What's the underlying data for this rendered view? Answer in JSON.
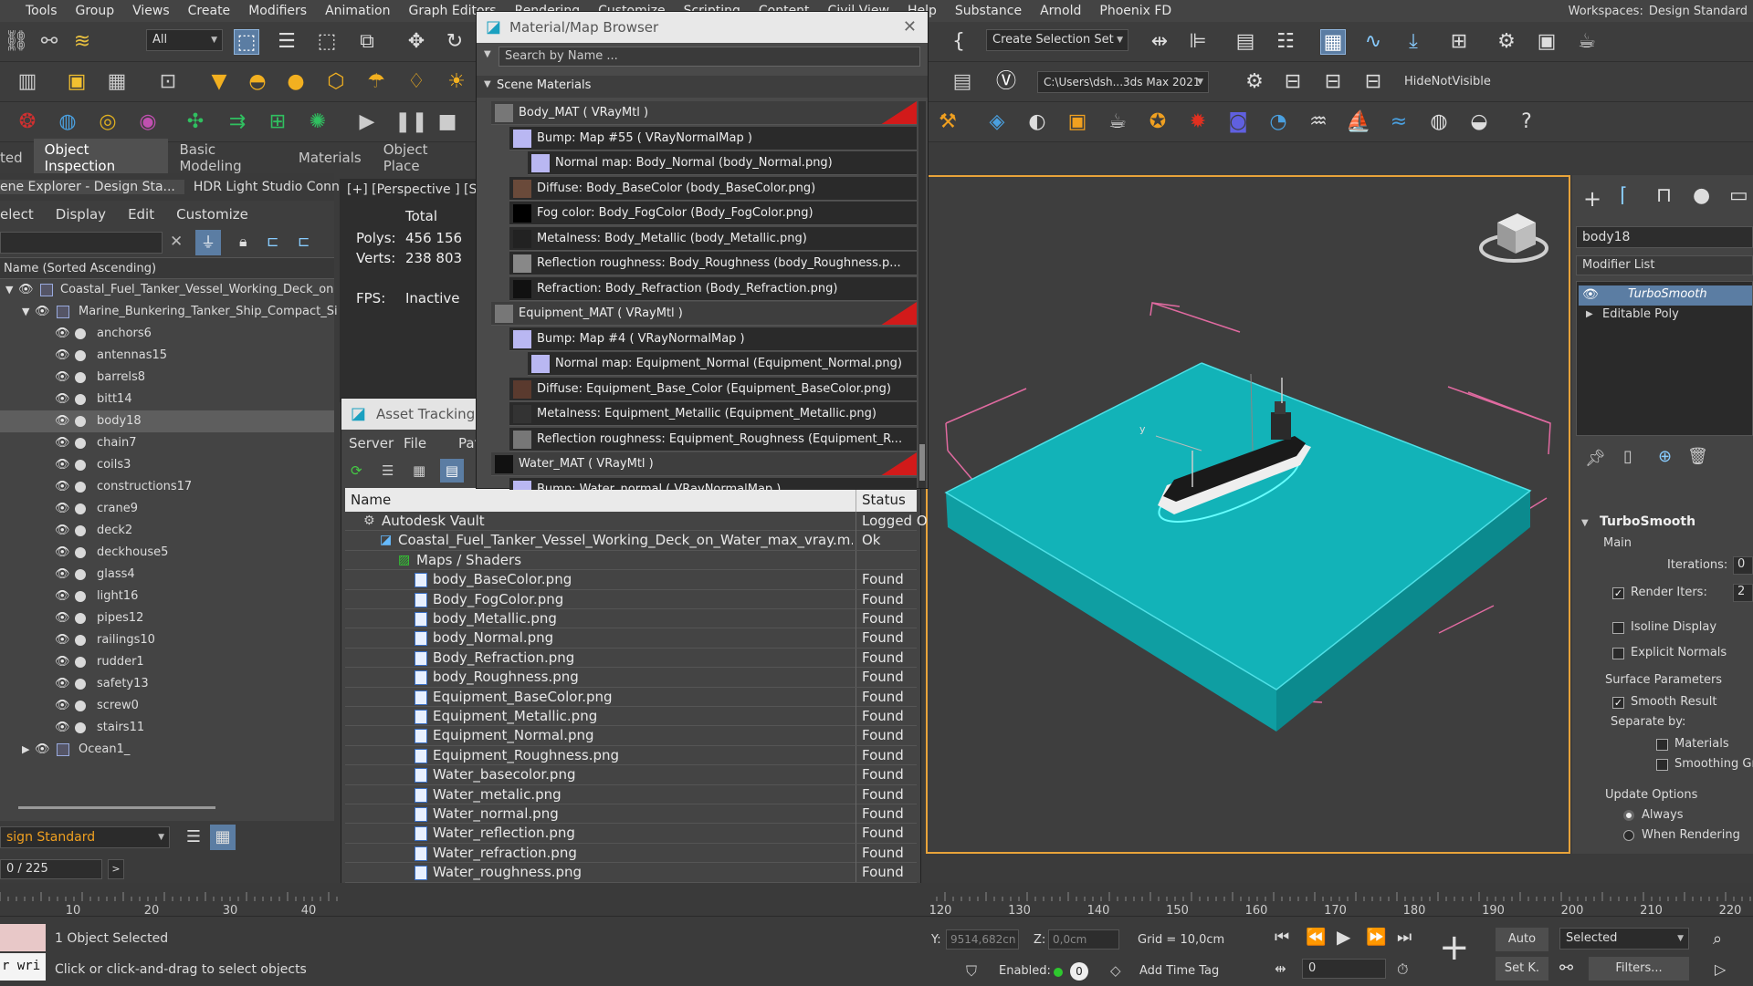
{
  "menubar": {
    "items": [
      "Tools",
      "Group",
      "Views",
      "Create",
      "Modifiers",
      "Animation",
      "Graph Editors",
      "Rendering",
      "Customize",
      "Scripting",
      "Content",
      "Civil View",
      "Help",
      "Substance",
      "Arnold",
      "Phoenix FD"
    ],
    "workspaces_label": "Workspaces:",
    "workspace_value": "Design Standard"
  },
  "toolbar": {
    "selection_filter": "All",
    "create_selection_set": "Create Selection Set",
    "path": "C:\\Users\\dsh...3ds Max 2021",
    "hide_not_visible": "HideNotVisible"
  },
  "ribbon": {
    "tabs": [
      "ted",
      "Object Inspection",
      "Basic Modeling",
      "Materials",
      "Object Place"
    ]
  },
  "scene_explorer": {
    "tabs": [
      "ene Explorer - Design Sta...",
      "HDR Light Studio Conn..."
    ],
    "menu": [
      "elect",
      "Display",
      "Edit",
      "Customize"
    ],
    "column_header": "Name (Sorted Ascending)",
    "tree": [
      {
        "label": "Coastal_Fuel_Tanker_Vessel_Working_Deck_on",
        "level": 0
      },
      {
        "label": "Marine_Bunkering_Tanker_Ship_Compact_Si",
        "level": 1
      },
      {
        "label": "anchors6",
        "level": 2
      },
      {
        "label": "antennas15",
        "level": 2
      },
      {
        "label": "barrels8",
        "level": 2
      },
      {
        "label": "bitt14",
        "level": 2
      },
      {
        "label": "body18",
        "level": 2,
        "selected": true
      },
      {
        "label": "chain7",
        "level": 2
      },
      {
        "label": "coils3",
        "level": 2
      },
      {
        "label": "constructions17",
        "level": 2
      },
      {
        "label": "crane9",
        "level": 2
      },
      {
        "label": "deck2",
        "level": 2
      },
      {
        "label": "deckhouse5",
        "level": 2
      },
      {
        "label": "glass4",
        "level": 2
      },
      {
        "label": "light16",
        "level": 2
      },
      {
        "label": "pipes12",
        "level": 2
      },
      {
        "label": "railings10",
        "level": 2
      },
      {
        "label": "rudder1",
        "level": 2
      },
      {
        "label": "safety13",
        "level": 2
      },
      {
        "label": "screw0",
        "level": 2
      },
      {
        "label": "stairs11",
        "level": 2
      },
      {
        "label": "Ocean1_",
        "level": 1
      }
    ],
    "layer_label": "sign Standard",
    "frame_counter": "0 / 225"
  },
  "viewport_stats": {
    "label": "[+] [Perspective ] [S",
    "total": "Total",
    "polys_label": "Polys:",
    "polys_value": "456 156",
    "verts_label": "Verts:",
    "verts_value": "238 803",
    "fps_label": "FPS:",
    "fps_value": "Inactive"
  },
  "material_browser": {
    "title": "Material/Map Browser",
    "search_placeholder": "Search by Name ...",
    "section": "Scene Materials",
    "rows": [
      {
        "text": "Body_MAT  ( VRayMtl )",
        "kind": "mat",
        "indent": 0,
        "swatch": "#777"
      },
      {
        "text": "Bump: Map #55  ( VRayNormalMap )",
        "kind": "map",
        "indent": 1,
        "swatch": "#b9b7f2"
      },
      {
        "text": "Normal map: Body_Normal (body_Normal.png)",
        "kind": "map",
        "indent": 2,
        "swatch": "#b9b7f2"
      },
      {
        "text": "Diffuse: Body_BaseColor (body_BaseColor.png)",
        "kind": "map",
        "indent": 1,
        "swatch": "#6a4a3a"
      },
      {
        "text": "Fog color: Body_FogColor (Body_FogColor.png)",
        "kind": "map",
        "indent": 1,
        "swatch": "#000000"
      },
      {
        "text": "Metalness: Body_Metallic (body_Metallic.png)",
        "kind": "map",
        "indent": 1,
        "swatch": "#222222"
      },
      {
        "text": "Reflection  roughness:  Body_Roughness  (body_Roughness.p...",
        "kind": "map",
        "indent": 1,
        "swatch": "#888888"
      },
      {
        "text": "Refraction: Body_Refraction (Body_Refraction.png)",
        "kind": "map",
        "indent": 1,
        "swatch": "#111111"
      },
      {
        "text": "Equipment_MAT  ( VRayMtl )",
        "kind": "mat",
        "indent": 0,
        "swatch": "#777"
      },
      {
        "text": "Bump: Map #4  ( VRayNormalMap )",
        "kind": "map",
        "indent": 1,
        "swatch": "#b9b7f2"
      },
      {
        "text": "Normal map: Equipment_Normal (Equipment_Normal.png)",
        "kind": "map",
        "indent": 2,
        "swatch": "#b9b7f2"
      },
      {
        "text": "Diffuse: Equipment_Base_Color (Equipment_BaseColor.png)",
        "kind": "map",
        "indent": 1,
        "swatch": "#5a3a2e"
      },
      {
        "text": "Metalness: Equipment_Metallic (Equipment_Metallic.png)",
        "kind": "map",
        "indent": 1,
        "swatch": "#333333"
      },
      {
        "text": "Reflection  roughness:  Equipment_Roughness  (Equipment_R...",
        "kind": "map",
        "indent": 1,
        "swatch": "#777777"
      },
      {
        "text": "Water_MAT  ( VRayMtl )",
        "kind": "mat",
        "indent": 0,
        "swatch": "#111"
      },
      {
        "text": "Bump: Water_normal  ( VRayNormalMap )",
        "kind": "map",
        "indent": 1,
        "swatch": "#b9b7f2"
      }
    ]
  },
  "asset_tracking": {
    "title": "Asset Tracking",
    "menu": [
      "Server",
      "File",
      "Path"
    ],
    "col_name": "Name",
    "col_status": "Status",
    "rows": [
      {
        "name": "Autodesk Vault",
        "status": "Logged O",
        "indent": 1,
        "icon": "vault"
      },
      {
        "name": "Coastal_Fuel_Tanker_Vessel_Working_Deck_on_Water_max_vray.m...",
        "status": "Ok",
        "indent": 2,
        "icon": "max"
      },
      {
        "name": "Maps / Shaders",
        "status": "",
        "indent": 3,
        "icon": "maps"
      },
      {
        "name": "body_BaseColor.png",
        "status": "Found",
        "indent": 4,
        "icon": "file"
      },
      {
        "name": "Body_FogColor.png",
        "status": "Found",
        "indent": 4,
        "icon": "file"
      },
      {
        "name": "body_Metallic.png",
        "status": "Found",
        "indent": 4,
        "icon": "file"
      },
      {
        "name": "body_Normal.png",
        "status": "Found",
        "indent": 4,
        "icon": "file"
      },
      {
        "name": "Body_Refraction.png",
        "status": "Found",
        "indent": 4,
        "icon": "file"
      },
      {
        "name": "body_Roughness.png",
        "status": "Found",
        "indent": 4,
        "icon": "file"
      },
      {
        "name": "Equipment_BaseColor.png",
        "status": "Found",
        "indent": 4,
        "icon": "file"
      },
      {
        "name": "Equipment_Metallic.png",
        "status": "Found",
        "indent": 4,
        "icon": "file"
      },
      {
        "name": "Equipment_Normal.png",
        "status": "Found",
        "indent": 4,
        "icon": "file"
      },
      {
        "name": "Equipment_Roughness.png",
        "status": "Found",
        "indent": 4,
        "icon": "file"
      },
      {
        "name": "Water_basecolor.png",
        "status": "Found",
        "indent": 4,
        "icon": "file"
      },
      {
        "name": "Water_metalic.png",
        "status": "Found",
        "indent": 4,
        "icon": "file"
      },
      {
        "name": "Water_normal.png",
        "status": "Found",
        "indent": 4,
        "icon": "file"
      },
      {
        "name": "Water_reflection.png",
        "status": "Found",
        "indent": 4,
        "icon": "file"
      },
      {
        "name": "Water_refraction.png",
        "status": "Found",
        "indent": 4,
        "icon": "file"
      },
      {
        "name": "Water_roughness.png",
        "status": "Found",
        "indent": 4,
        "icon": "file"
      }
    ]
  },
  "command_panel": {
    "object_name": "body18",
    "modifier_list": "Modifier List",
    "stack": [
      "TurboSmooth",
      "Editable Poly"
    ],
    "rollout_title": "TurboSmooth",
    "main": "Main",
    "iterations_label": "Iterations:",
    "iterations_value": "0",
    "render_iters_label": "Render Iters:",
    "render_iters_value": "2",
    "isoline": "Isoline Display",
    "explicit_normals": "Explicit Normals",
    "surface_params": "Surface Parameters",
    "smooth_result": "Smooth Result",
    "separate_by": "Separate by:",
    "materials": "Materials",
    "smoothing_groups": "Smoothing Gr",
    "update_options": "Update Options",
    "always": "Always",
    "when_rendering": "When Rendering"
  },
  "timeline": {
    "left_ticks": [
      "10",
      "20",
      "30",
      "40"
    ],
    "right_ticks": [
      "120",
      "130",
      "140",
      "150",
      "160",
      "170",
      "180",
      "190",
      "200",
      "210",
      "220"
    ]
  },
  "statusbar": {
    "maxscript": "r wri",
    "selected": "1 Object Selected",
    "hint": "Click or click-and-drag to select objects",
    "y_label": "Y:",
    "y_value": "9514,682cn",
    "z_label": "Z:",
    "z_value": "0,0cm",
    "grid": "Grid = 10,0cm",
    "enabled": "Enabled:",
    "add_time_tag": "Add Time Tag",
    "frame": "0",
    "auto": "Auto",
    "set_key": "Set K.",
    "selected_dd": "Selected",
    "filters": "Filters..."
  },
  "colors": {
    "accent": "#5b7da3",
    "viewport_border": "#e8a33a",
    "water_cyan": "#12b3b8",
    "bbox_pink": "#e06aa0",
    "found_red": "#d21a1a"
  }
}
